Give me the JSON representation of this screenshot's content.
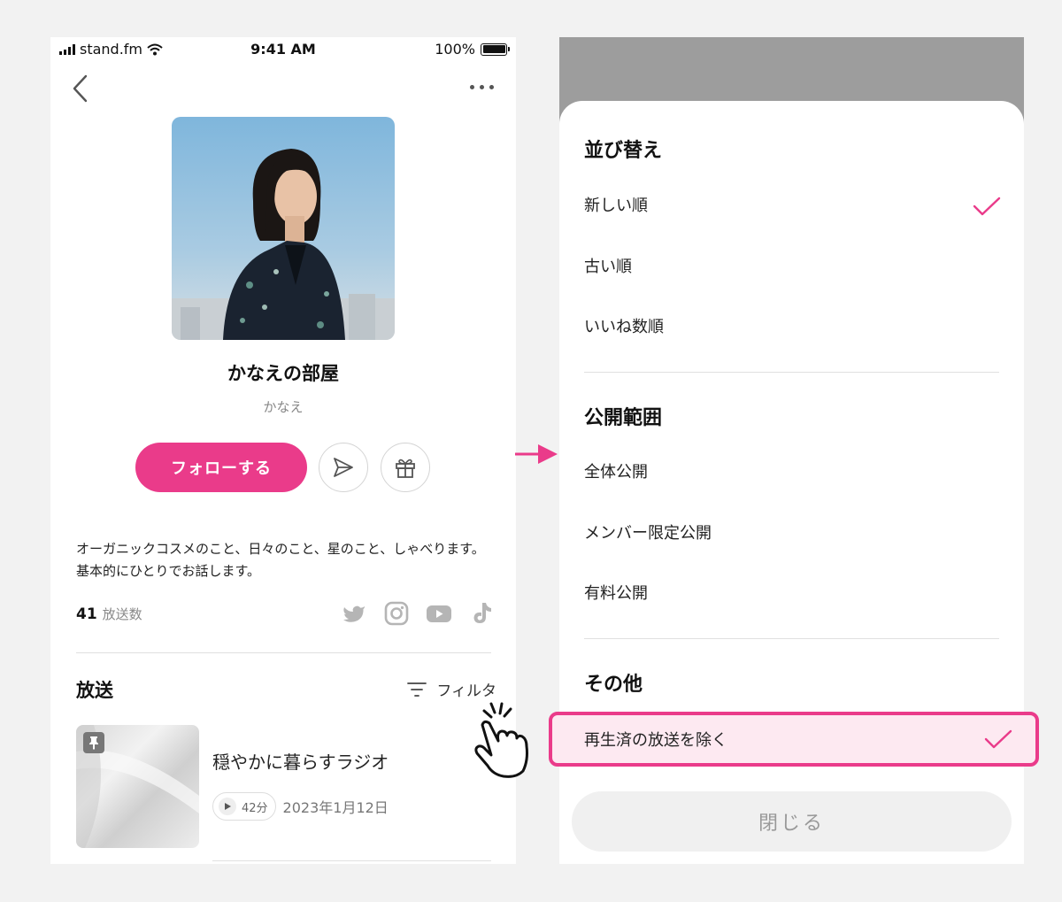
{
  "status_bar": {
    "carrier": "stand.fm",
    "time": "9:41 AM",
    "battery": "100%"
  },
  "nav": {
    "back_icon": "chevron-left-icon",
    "more_icon": "more-horizontal-icon"
  },
  "channel": {
    "title": "かなえの部屋",
    "author": "かなえ",
    "follow_label": "フォローする",
    "description": "オーガニックコスメのこと、日々のこと、星のこと、しゃべります。基本的にひとりでお話します。",
    "broadcast_count": "41",
    "broadcast_count_label": "放送数",
    "social_icons": [
      "twitter-icon",
      "instagram-icon",
      "youtube-icon",
      "tiktok-icon"
    ]
  },
  "broadcasts": {
    "section_title": "放送",
    "filter_label": "フィルタ",
    "episodes": [
      {
        "title": "穏やかに暮らすラジオ",
        "duration": "42分",
        "date": "2023年1月12日"
      }
    ]
  },
  "filter_sheet": {
    "sort_heading": "並び替え",
    "sort_options": [
      {
        "label": "新しい順",
        "checked": true
      },
      {
        "label": "古い順",
        "checked": false
      },
      {
        "label": "いいね数順",
        "checked": false
      }
    ],
    "scope_heading": "公開範囲",
    "scope_options": [
      {
        "label": "全体公開"
      },
      {
        "label": "メンバー限定公開"
      },
      {
        "label": "有料公開"
      }
    ],
    "other_heading": "その他",
    "other_options": [
      {
        "label": "再生済の放送を除く",
        "checked": true
      }
    ],
    "close_label": "閉じる"
  },
  "colors": {
    "accent": "#ea3b8a",
    "highlight_bg": "#fde9f1",
    "overlay": "#9d9d9d"
  }
}
